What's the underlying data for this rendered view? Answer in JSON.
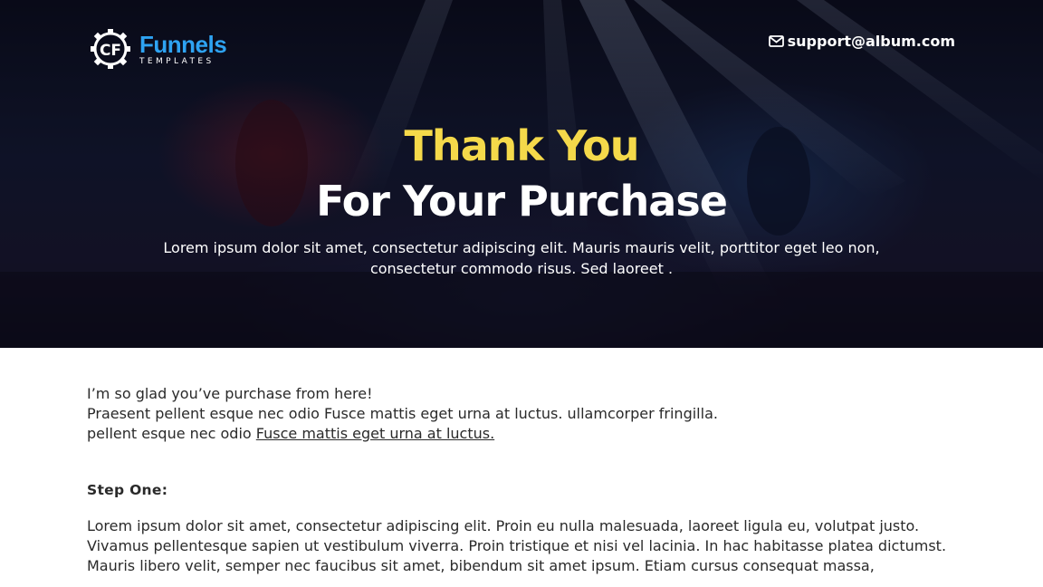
{
  "header": {
    "logo": {
      "brand": "Funnels",
      "sub": "TEMPLATES",
      "mark": "CF"
    },
    "support": {
      "icon": "envelope-icon",
      "email": "support@album.com"
    }
  },
  "hero": {
    "title_line1": "Thank You",
    "title_line2": "For Your Purchase",
    "subtitle_line1": "Lorem ipsum dolor sit amet, consectetur adipiscing elit. Mauris mauris velit, porttitor eget leo non,",
    "subtitle_line2": "consectetur commodo risus. Sed laoreet .",
    "colors": {
      "accent": "#f5d94a",
      "brand": "#2ea3f2"
    }
  },
  "intro": {
    "line1": "I’m so glad you’ve purchase from here!",
    "line2": "Praesent pellent esque nec odio Fusce mattis eget urna at luctus. ullamcorper fringilla.",
    "line3_prefix": "pellent esque nec odio ",
    "line3_link": "Fusce mattis eget urna at luctus."
  },
  "step_one": {
    "title": "Step One:",
    "lines": [
      "Lorem ipsum dolor sit amet, consectetur adipiscing elit. Proin eu nulla malesuada, laoreet ligula eu, volutpat justo.",
      "Vivamus pellentesque sapien ut vestibulum viverra. Proin tristique et nisi vel lacinia. In hac habitasse platea dictumst.",
      "Mauris libero velit, semper nec faucibus sit amet, bibendum sit amet ipsum. Etiam cursus consequat massa,"
    ]
  }
}
